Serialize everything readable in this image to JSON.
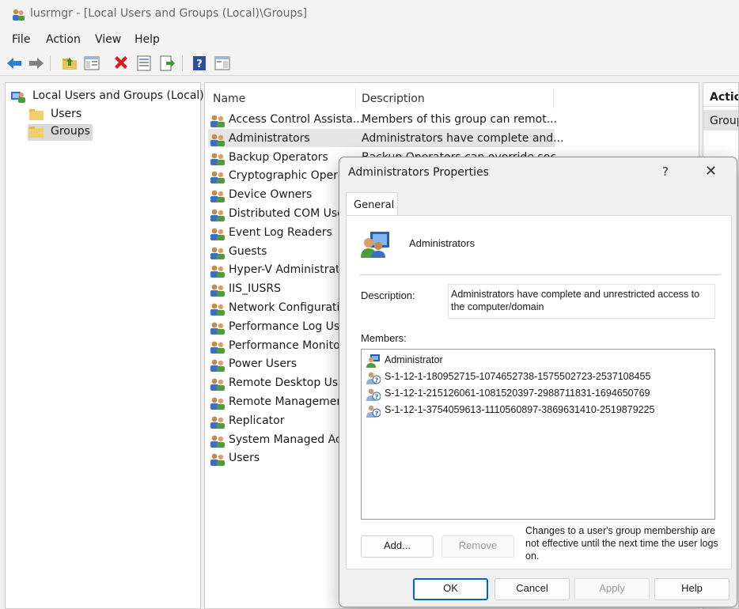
{
  "window": {
    "title": "lusrmgr - [Local Users and Groups (Local)\\Groups]",
    "icon": "users-groups-icon"
  },
  "menu": [
    "File",
    "Action",
    "View",
    "Help"
  ],
  "toolbar": {
    "buttons": [
      "back-arrow-icon",
      "forward-arrow-icon",
      "up-folder-icon",
      "show-hide-tree-icon",
      "delete-icon",
      "properties-icon",
      "export-list-icon",
      "help-icon",
      "action-pane-icon"
    ]
  },
  "tree": {
    "root": "Local Users and Groups (Local)",
    "items": [
      "Users",
      "Groups"
    ],
    "selected": "Groups"
  },
  "list": {
    "columns": [
      "Name",
      "Description"
    ],
    "rows": [
      {
        "name": "Access Control Assista...",
        "desc": "Members of this group can remot..."
      },
      {
        "name": "Administrators",
        "desc": "Administrators have complete and..."
      },
      {
        "name": "Backup Operators",
        "desc": "Backup Operators can override sec..."
      },
      {
        "name": "Cryptographic Operators",
        "desc": ""
      },
      {
        "name": "Device Owners",
        "desc": ""
      },
      {
        "name": "Distributed COM Users",
        "desc": ""
      },
      {
        "name": "Event Log Readers",
        "desc": ""
      },
      {
        "name": "Guests",
        "desc": ""
      },
      {
        "name": "Hyper-V Administrators",
        "desc": ""
      },
      {
        "name": "IIS_IUSRS",
        "desc": ""
      },
      {
        "name": "Network Configuration Operators",
        "desc": ""
      },
      {
        "name": "Performance Log Users",
        "desc": ""
      },
      {
        "name": "Performance Monitor Users",
        "desc": ""
      },
      {
        "name": "Power Users",
        "desc": ""
      },
      {
        "name": "Remote Desktop Users",
        "desc": ""
      },
      {
        "name": "Remote Management Users",
        "desc": ""
      },
      {
        "name": "Replicator",
        "desc": ""
      },
      {
        "name": "System Managed Accounts Group",
        "desc": ""
      },
      {
        "name": "Users",
        "desc": ""
      }
    ]
  },
  "actions": {
    "header": "Actions",
    "group": "Groups"
  },
  "dialog": {
    "title": "Administrators Properties",
    "help": "?",
    "close": "✕",
    "tab": "General",
    "group_name": "Administrators",
    "description_label": "Description:",
    "description": "Administrators have complete and unrestricted access to the computer/domain",
    "members_label": "Members:",
    "members": [
      {
        "name": "Administrator",
        "icon": "user-icon"
      },
      {
        "name": "S-1-12-1-180952715-1074652738-1575502723-2537108455",
        "icon": "unknown-account-icon"
      },
      {
        "name": "S-1-12-1-215126061-1081520397-2988711831-1694650769",
        "icon": "unknown-account-icon"
      },
      {
        "name": "S-1-12-1-3754059613-1110560897-3869631410-2519879225",
        "icon": "unknown-account-icon"
      }
    ],
    "add_button": "Add...",
    "remove_button": "Remove",
    "note": "Changes to a user's group membership are not effective until the next time the user logs on.",
    "ok_button": "OK",
    "cancel_button": "Cancel",
    "apply_button": "Apply",
    "help_button": "Help"
  }
}
